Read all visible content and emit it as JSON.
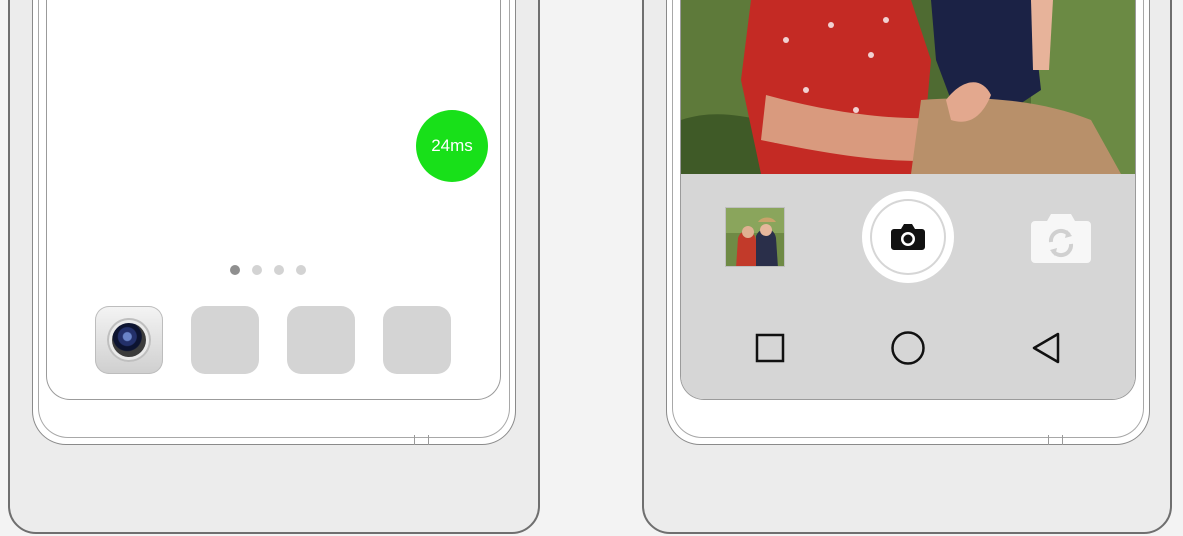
{
  "left_phone": {
    "latency_badge": "24ms",
    "page_dots": {
      "count": 4,
      "active_index": 0
    },
    "dock": [
      "camera-app",
      "app-placeholder",
      "app-placeholder",
      "app-placeholder"
    ]
  },
  "right_phone": {
    "controls": {
      "gallery_thumbnail": "gallery-thumbnail",
      "shutter": "camera-icon",
      "switch_camera": "switch-camera-icon"
    },
    "nav_bar": [
      "square-icon",
      "circle-icon",
      "triangle-back-icon"
    ]
  },
  "colors": {
    "latency_green": "#18e019",
    "camera_bar": "#d6d6d6",
    "background": "#f3f3f3"
  }
}
